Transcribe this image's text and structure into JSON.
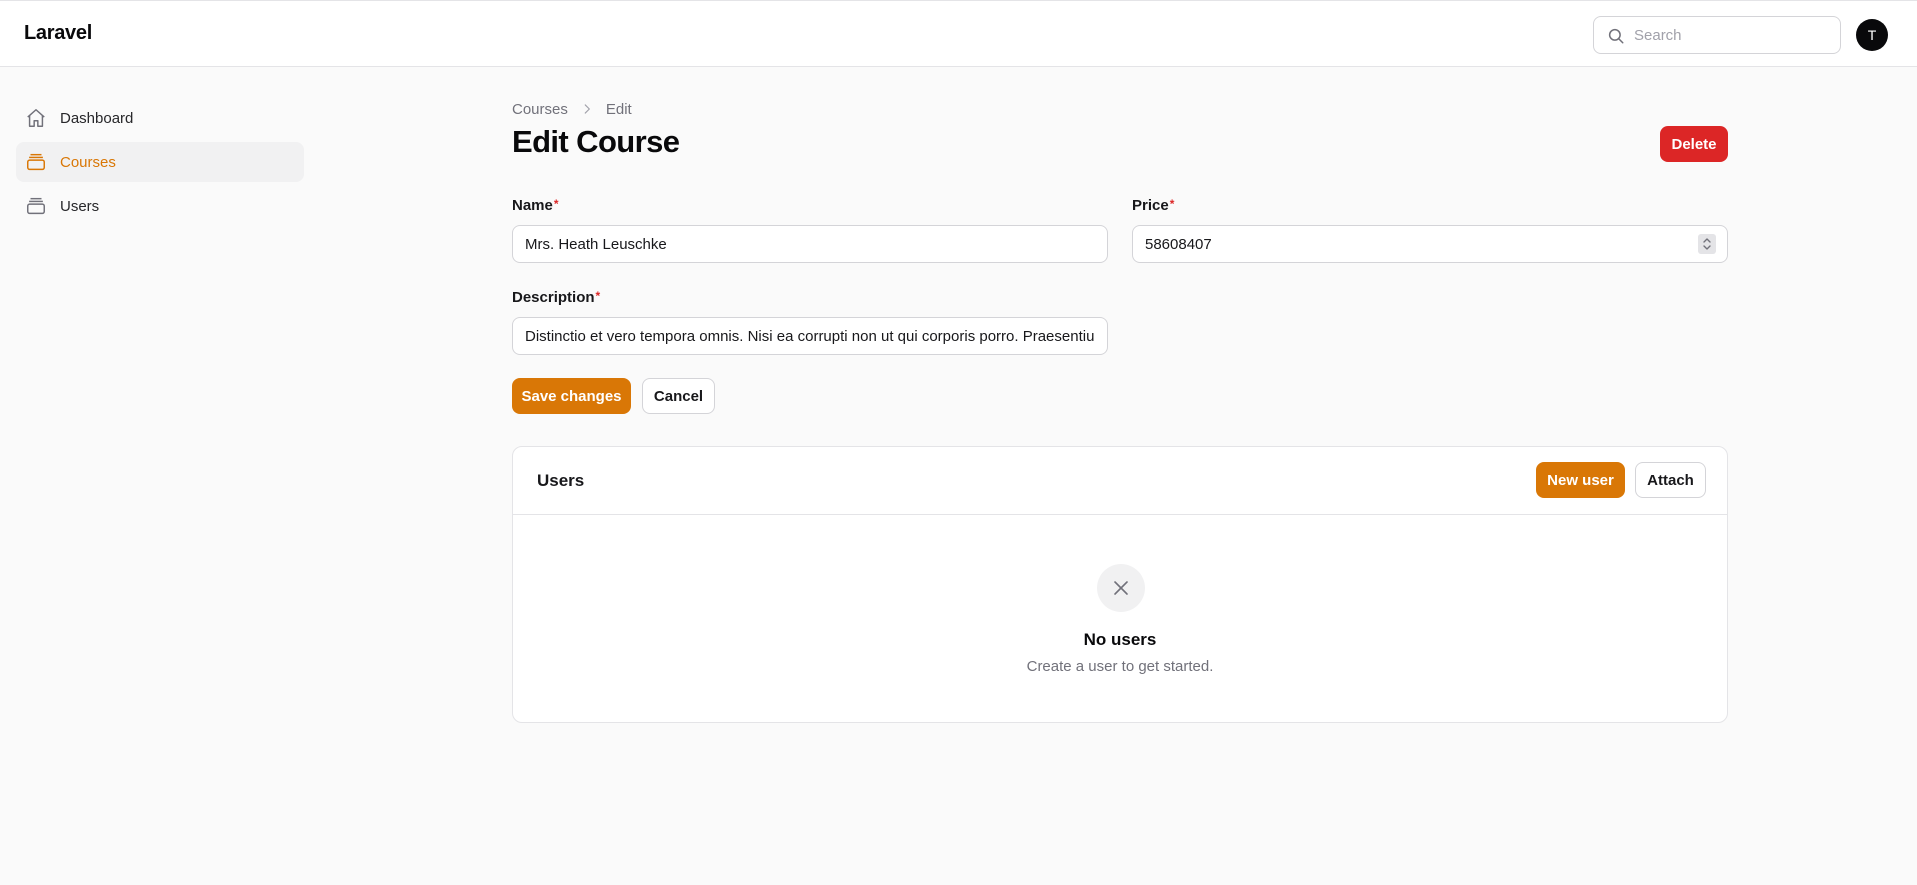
{
  "app": {
    "brand": "Laravel"
  },
  "header": {
    "search_placeholder": "Search",
    "avatar_initial": "T"
  },
  "sidebar": {
    "items": [
      {
        "label": "Dashboard",
        "icon": "home-icon",
        "active": false
      },
      {
        "label": "Courses",
        "icon": "box-icon",
        "active": true
      },
      {
        "label": "Users",
        "icon": "box-icon",
        "active": false
      }
    ]
  },
  "breadcrumb": {
    "parent": "Courses",
    "current": "Edit"
  },
  "page": {
    "title": "Edit Course",
    "delete_label": "Delete"
  },
  "form": {
    "name": {
      "label": "Name",
      "required": "*",
      "value": "Mrs. Heath Leuschke"
    },
    "price": {
      "label": "Price",
      "required": "*",
      "value": "58608407"
    },
    "description": {
      "label": "Description",
      "required": "*",
      "value": "Distinctio et vero tempora omnis. Nisi ea corrupti non ut qui corporis porro. Praesentium"
    },
    "save_label": "Save changes",
    "cancel_label": "Cancel"
  },
  "users_panel": {
    "title": "Users",
    "new_label": "New user",
    "attach_label": "Attach",
    "empty_title": "No users",
    "empty_subtitle": "Create a user to get started."
  },
  "colors": {
    "accent": "#d97706",
    "danger": "#dc2626",
    "background": "#fafafa"
  }
}
